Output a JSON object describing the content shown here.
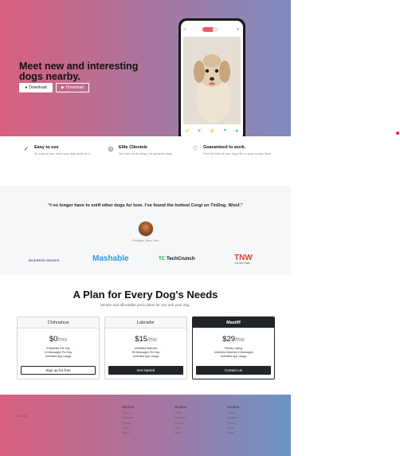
{
  "hero": {
    "title": "Meet new and interesting dogs nearby.",
    "download_apple": "Download",
    "download_play": "Download",
    "phone": {
      "user_icon": "user-icon",
      "chat_icon": "chat-icon"
    },
    "actions": [
      {
        "icon": "undo-icon",
        "glyph": "↺",
        "color": "#f5b800"
      },
      {
        "icon": "close-icon",
        "glyph": "✕",
        "color": "#f2596b"
      },
      {
        "icon": "bolt-icon",
        "glyph": "⚡",
        "color": "#a067e2"
      },
      {
        "icon": "heart-icon",
        "glyph": "♥",
        "color": "#39d6a3"
      },
      {
        "icon": "star-icon",
        "glyph": "★",
        "color": "#2fbadb"
      }
    ]
  },
  "features": [
    {
      "icon": "check-circle-icon",
      "title": "Easy to use",
      "text": "So easy to use, even your dog could do it."
    },
    {
      "icon": "bullseye-icon",
      "title": "Elite Clientele",
      "text": "We have all the dogs, the greatest dogs."
    },
    {
      "icon": "heart-arrow-icon",
      "title": "Guaranteed to work.",
      "text": "Find the love of your dog's life or your money back."
    }
  ],
  "testimonial": {
    "quote": "“I no longer have to sniff other dogs for love. I’ve found the hottest Corgi on TinDog. Woof.”",
    "author": "Pebbles, New York"
  },
  "press": {
    "business_insider": "BUSINESS INSIDER",
    "mashable": "Mashable",
    "techcrunch_tc": "TC",
    "techcrunch": "TechCrunch",
    "tnw": "TNW",
    "tnw_sub": "THE NEXT WEB"
  },
  "pricing": {
    "title": "A Plan for Every Dog's Needs",
    "subtitle": "Simple and affordable price plans for you and your dog.",
    "plans": [
      {
        "name": "Chihuahua",
        "price": "$0",
        "per": "/mo",
        "features": [
          "5 Matches Per Day",
          "10 Messages Per Day",
          "Unlimited App Usage"
        ],
        "button": "Sign up for free"
      },
      {
        "name": "Labrador",
        "price": "$15",
        "per": "/mo",
        "features": [
          "Unlimited Matches",
          "50 Messages Per Day",
          "Unlimited App Usage"
        ],
        "button": "Get started"
      },
      {
        "name": "Mastiff",
        "price": "$29",
        "per": "/mo",
        "features": [
          "Priority Listing",
          "Unlimited Matches & Messages",
          "Unlimited App Usage"
        ],
        "button": "Contact us"
      }
    ]
  },
  "footer": {
    "copyright": "© 2024",
    "columns": [
      {
        "heading": "Section",
        "links": [
          "Home",
          "Features",
          "Pricing",
          "FAQs",
          "About"
        ]
      },
      {
        "heading": "Section",
        "links": [
          "Home",
          "Features",
          "Pricing",
          "FAQs",
          "About"
        ]
      },
      {
        "heading": "Section",
        "links": [
          "Home",
          "Features",
          "Pricing",
          "FAQs",
          "About"
        ]
      }
    ]
  }
}
